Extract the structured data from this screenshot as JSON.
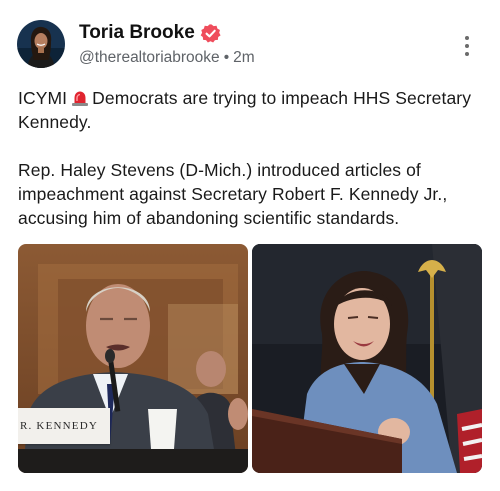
{
  "post": {
    "author": {
      "name": "Toria Brooke",
      "handle": "@therealtoriabrooke",
      "separator": "•",
      "time": "2m",
      "verified_color": "#ef4d5c"
    },
    "paragraph1": {
      "before": "ICYMI",
      "emoji": "siren-icon",
      "after": "Democrats are trying to impeach HHS Secretary Kennedy."
    },
    "paragraph2": "Rep. Haley Stevens (D-Mich.) introduced articles of impeachment against Secretary Robert F. Kennedy Jr., accusing him of abandoning scientific standards.",
    "images": {
      "left_nameplate": "R. KENNEDY"
    }
  }
}
